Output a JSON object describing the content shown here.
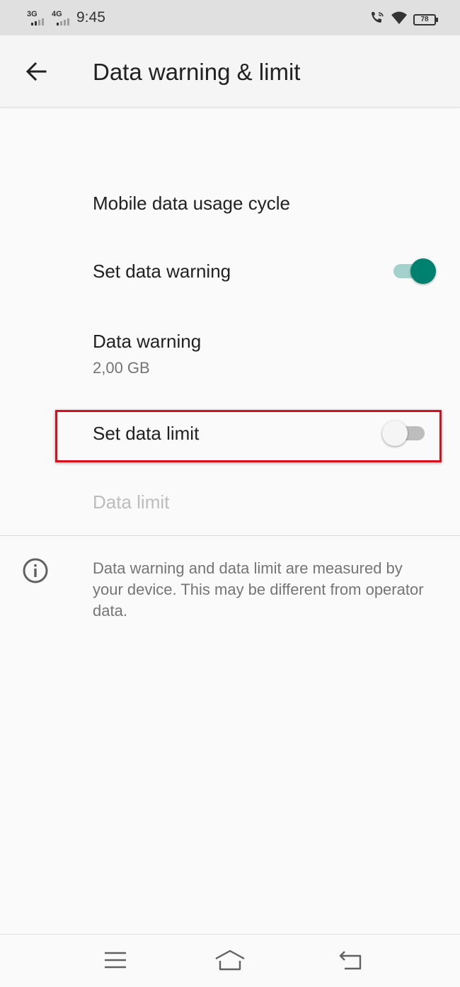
{
  "status_bar": {
    "network_1": "3G",
    "network_2": "4G",
    "time": "9:45",
    "battery": "78",
    "icons": [
      "call-wifi-icon",
      "wifi-icon",
      "battery-icon"
    ]
  },
  "app_bar": {
    "title": "Data warning & limit",
    "back_icon": "arrow-back-icon"
  },
  "settings": {
    "usage_cycle": {
      "title": "Mobile data usage cycle"
    },
    "set_warning": {
      "title": "Set data warning",
      "enabled": true
    },
    "data_warning": {
      "title": "Data warning",
      "value": "2,00 GB"
    },
    "set_limit": {
      "title": "Set data limit",
      "enabled": false
    },
    "data_limit": {
      "title": "Data limit",
      "disabled": true
    }
  },
  "info": {
    "icon": "info-icon",
    "text": "Data warning and data limit are measured by your device. This may be different from operator data."
  },
  "colors": {
    "accent": "#00806f",
    "highlight": "#d6111e"
  },
  "nav_bar": {
    "icons": [
      "menu-icon",
      "home-icon",
      "back-icon"
    ]
  }
}
